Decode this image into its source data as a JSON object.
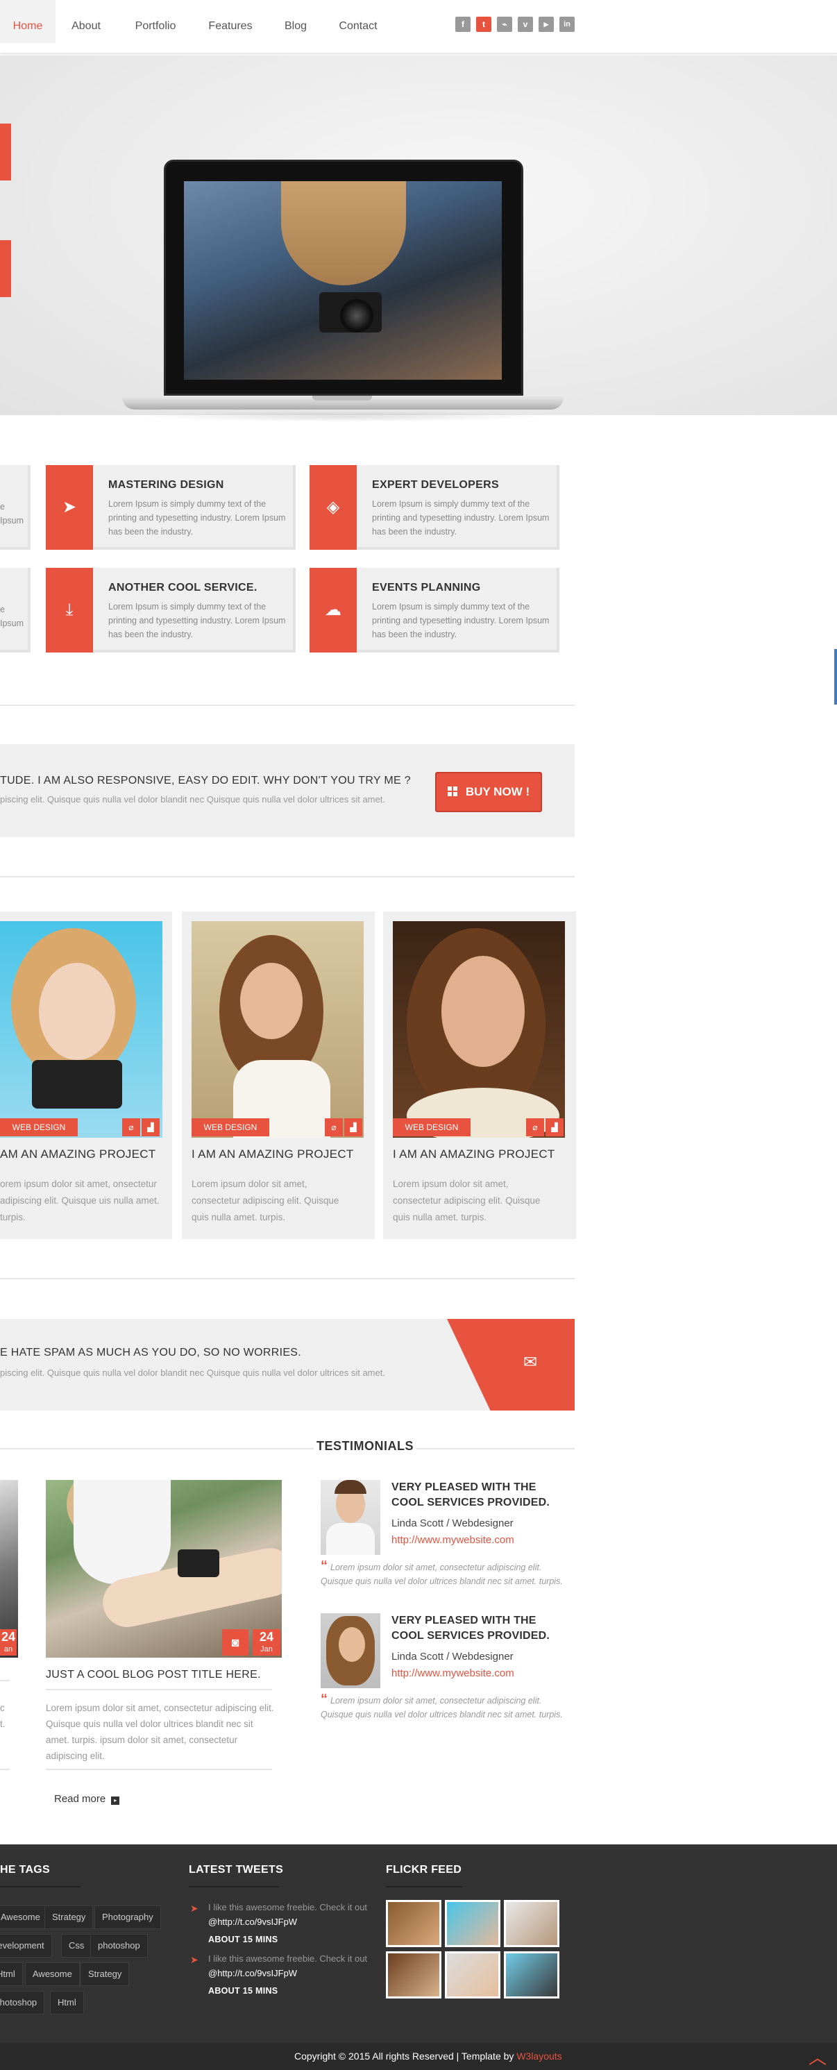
{
  "nav": {
    "items": [
      "Home",
      "About",
      "Portfolio",
      "Features",
      "Blog",
      "Contact"
    ],
    "active": "Home",
    "social_icons": [
      "facebook-icon",
      "twitter-icon",
      "rss-icon",
      "vimeo-icon",
      "youtube-icon",
      "linkedin-icon"
    ],
    "social_glyphs": [
      "f",
      "t",
      "⌁",
      "v",
      "▶",
      "in"
    ]
  },
  "services": {
    "partial_text": [
      "e",
      "Ipsum",
      "e",
      "Ipsum"
    ],
    "cards": [
      {
        "title": "MASTERING DESIGN",
        "text": "Lorem Ipsum is simply dummy text of the printing and typesetting industry. Lorem Ipsum has been the industry.",
        "icon": "cursor-icon",
        "glyph": "➤"
      },
      {
        "title": "EXPERT DEVELOPERS",
        "text": "Lorem Ipsum is simply dummy text of the printing and typesetting industry. Lorem Ipsum has been the industry.",
        "icon": "layers-icon",
        "glyph": "◈"
      },
      {
        "title": "ANOTHER COOL SERVICE.",
        "text": "Lorem Ipsum is simply dummy text of the printing and typesetting industry. Lorem Ipsum has been the industry.",
        "icon": "download-icon",
        "glyph": "⤓"
      },
      {
        "title": "EVENTS PLANNING",
        "text": "Lorem Ipsum is simply dummy text of the printing and typesetting industry. Lorem Ipsum has been the industry.",
        "icon": "cloud-icon",
        "glyph": "☁"
      }
    ]
  },
  "cta": {
    "title": "TUDE. I AM ALSO RESPONSIVE, EASY DO EDIT. WHY DON'T YOU TRY ME ?",
    "subtitle": "piscing elit. Quisque quis nulla vel dolor blandit nec Quisque quis nulla vel dolor ultrices sit amet.",
    "button": "BUY NOW !"
  },
  "portfolio": [
    {
      "tag": "WEB DESIGN",
      "title": "AM AN AMAZING PROJECT",
      "text": "orem ipsum dolor sit amet, onsectetur adipiscing elit. Quisque uis nulla amet. turpis."
    },
    {
      "tag": "WEB DESIGN",
      "title": "I AM AN AMAZING PROJECT",
      "text": "Lorem ipsum dolor sit amet, consectetur adipiscing elit. Quisque quis nulla amet. turpis."
    },
    {
      "tag": "WEB DESIGN",
      "title": "I AM AN AMAZING PROJECT",
      "text": "Lorem ipsum dolor sit amet, consectetur adipiscing elit. Quisque quis nulla amet. turpis."
    }
  ],
  "newsletter": {
    "title": "E HATE SPAM AS MUCH AS YOU DO, SO NO WORRIES.",
    "subtitle": "piscing elit. Quisque quis nulla vel dolor blandit nec Quisque quis nulla vel dolor ultrices sit amet."
  },
  "testimonials_heading": "TESTIMONIALS",
  "blog": {
    "partial_date": {
      "day": "24",
      "month": "an"
    },
    "partial_text": [
      "",
      "c",
      "",
      "t."
    ],
    "date_day": "24",
    "date_month": "Jan",
    "title": "JUST A COOL BLOG POST TITLE HERE.",
    "text": "Lorem ipsum dolor sit amet, consectetur adipiscing elit. Quisque quis nulla vel dolor ultrices blandit nec sit amet. turpis. ipsum dolor sit amet, consectetur adipiscing elit.",
    "read_more": "Read more"
  },
  "testimonials": [
    {
      "title": "VERY PLEASED WITH THE COOL SERVICES PROVIDED.",
      "name": "Linda Scott / Webdesigner",
      "link": "http://www.mywebsite.com",
      "quote": "Lorem ipsum dolor sit amet, consectetur adipiscing elit. Quisque quis nulla vel dolor ultrices blandit nec sit amet. turpis."
    },
    {
      "title": "VERY PLEASED WITH THE COOL SERVICES PROVIDED.",
      "name": "Linda Scott / Webdesigner",
      "link": "http://www.mywebsite.com",
      "quote": "Lorem ipsum dolor sit amet, consectetur adipiscing elit. Quisque quis nulla vel dolor ultrices blandit nec sit amet. turpis."
    }
  ],
  "footer": {
    "tags_heading": "HE TAGS",
    "tags": [
      "Awesome",
      "Strategy",
      "Photography",
      "Development",
      "Css",
      "photoshop",
      "Html",
      "Awesome",
      "Strategy",
      "Photoshop",
      "Html"
    ],
    "tweets_heading": "LATEST TWEETS",
    "tweets": [
      {
        "text": "I like this awesome freebie. Check it out",
        "link": "@http://t.co/9vsIJFpW",
        "time": "ABOUT 15 MINS"
      },
      {
        "text": "I like this awesome freebie. Check it out",
        "link": "@http://t.co/9vsIJFpW",
        "time": "ABOUT 15 MINS"
      }
    ],
    "flickr_heading": "FLICKR FEED",
    "copyright": "Copyright © 2015 All rights Reserved | Template by",
    "brand": "W3layouts"
  },
  "colors": {
    "accent": "#e8533f",
    "footer_bg": "#333333",
    "card_bg": "#efefef"
  }
}
